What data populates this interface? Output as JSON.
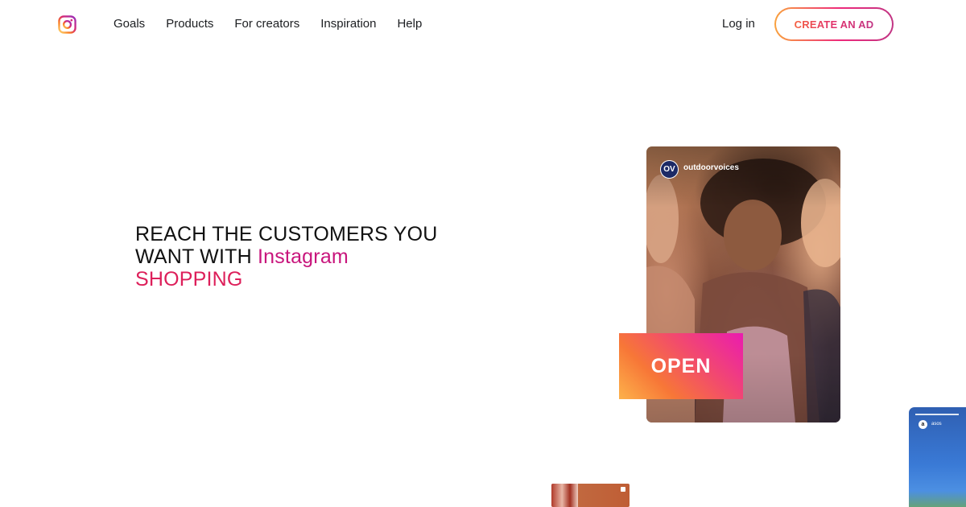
{
  "header": {
    "logo_icon": "instagram-logo-icon",
    "nav": [
      "Goals",
      "Products",
      "For creators",
      "Inspiration",
      "Help"
    ],
    "login_label": "Log in",
    "cta_label": "CREATE AN AD"
  },
  "hero": {
    "headline_line1": "REACH THE CUSTOMERS YOU",
    "headline_line2_plain": "WANT WITH ",
    "headline_line2_accent": "Instagram",
    "headline_line3_accent": "SHOPPING"
  },
  "post": {
    "avatar_text": "OV",
    "username": "outdoorvoices",
    "open_label": "OPEN"
  },
  "story": {
    "avatar_text": "a",
    "username": "asos"
  },
  "colors": {
    "accent_pink": "#c8157c",
    "accent_red": "#dd1f5a",
    "gradient_start": "#f9a23e",
    "gradient_end": "#c13584"
  }
}
